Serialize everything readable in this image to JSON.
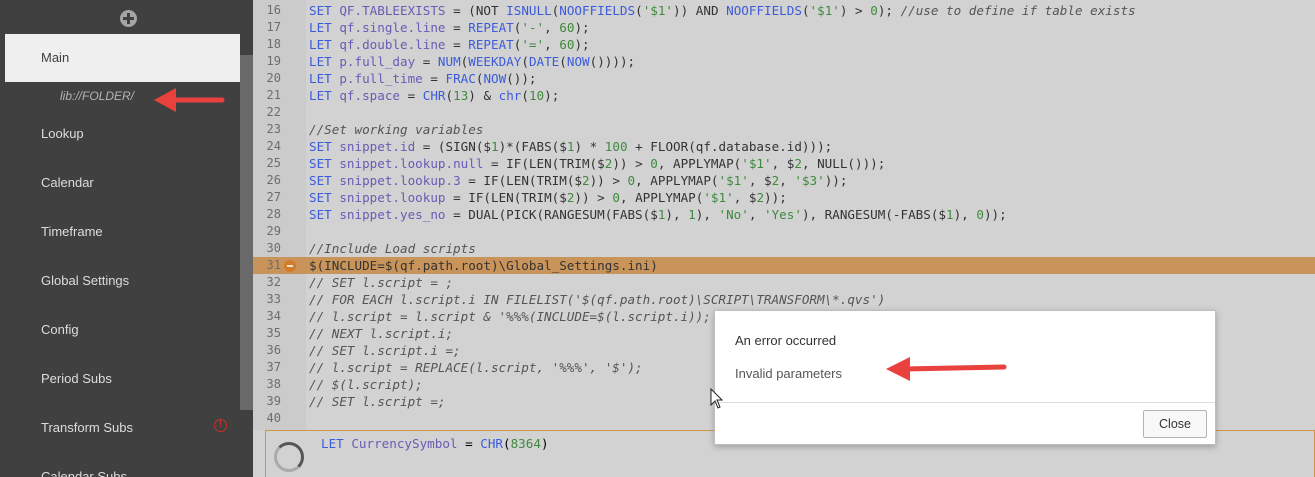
{
  "sidebar": {
    "add_label": "+",
    "items": [
      {
        "label": "Main",
        "active": true
      },
      {
        "label": "Lookup"
      },
      {
        "label": "Calendar"
      },
      {
        "label": "Timeframe"
      },
      {
        "label": "Global Settings"
      },
      {
        "label": "Config"
      },
      {
        "label": "Period Subs"
      },
      {
        "label": "Transform Subs",
        "warning": true
      },
      {
        "label": "Calendar Subs"
      }
    ],
    "lib_path": "lib://FOLDER/",
    "warning_icon": "!"
  },
  "editor": {
    "line_numbers": [
      "16",
      "17",
      "18",
      "19",
      "20",
      "21",
      "22",
      "23",
      "24",
      "25",
      "26",
      "27",
      "28",
      "29",
      "30",
      "31",
      "32",
      "33",
      "34",
      "35",
      "36",
      "37",
      "38",
      "39",
      "40"
    ],
    "lines": [
      "SET QF.TABLEEXISTS = (NOT ISNULL(NOOFFIELDS('$1')) AND NOOFFIELDS('$1') > 0); //use to define if table exists",
      "LET qf.single.line = REPEAT('-', 60);",
      "LET qf.double.line = REPEAT('=', 60);",
      "LET p.full_day = NUM(WEEKDAY(DATE(NOW())));",
      "LET p.full_time = FRAC(NOW());",
      "LET qf.space = CHR(13) & chr(10);",
      "",
      "//Set working variables",
      "SET snippet.id = (SIGN($1)*(FABS($1) * 100 + FLOOR(qf.database.id)));",
      "SET snippet.lookup.null = IF(LEN(TRIM($2)) > 0, APPLYMAP('$1', $2, NULL()));",
      "SET snippet.lookup.3 = IF(LEN(TRIM($2)) > 0, APPLYMAP('$1', $2, '$3'));",
      "SET snippet.lookup = IF(LEN(TRIM($2)) > 0, APPLYMAP('$1', $2));",
      "SET snippet.yes_no = DUAL(PICK(RANGESUM(FABS($1), 1), 'No', 'Yes'), RANGESUM(-FABS($1), 0));",
      "",
      "//Include Load scripts",
      "$(INCLUDE=$(qf.path.root)\\Global_Settings.ini)",
      "// SET l.script = ;",
      "// FOR EACH l.script.i IN FILELIST('$(qf.path.root)\\SCRIPT\\TRANSFORM\\*.qvs')",
      "// l.script = l.script & '%%%(INCLUDE=$(l.script.i));",
      "// NEXT l.script.i;",
      "// SET l.script.i =;",
      "// l.script = REPLACE(l.script, '%%%', '$');",
      "// $(l.script);",
      "// SET l.script =;",
      ""
    ],
    "highlighted_line": "31",
    "section2_code": "LET CurrencySymbol = CHR(8364)"
  },
  "dialog": {
    "title": "An error occurred",
    "message": "Invalid parameters",
    "close_label": "Close"
  },
  "colors": {
    "accent_arrow": "#e8413e",
    "highlight_line": "#c9945a",
    "sidebar_bg": "#404040"
  }
}
